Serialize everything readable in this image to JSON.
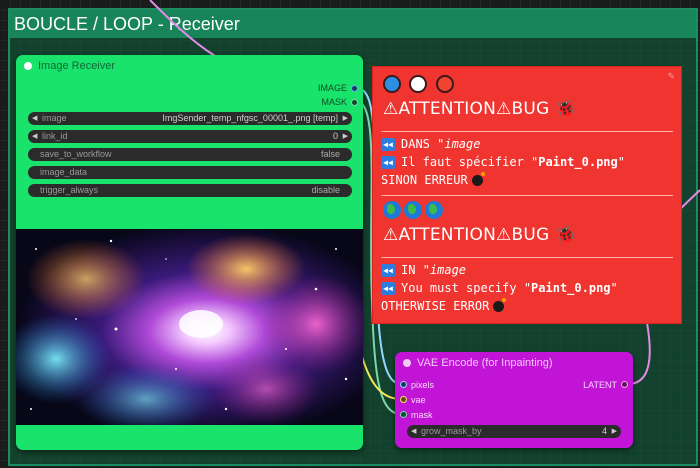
{
  "group": {
    "title": "BOUCLE / LOOP - Receiver"
  },
  "image_receiver": {
    "title": "Image Receiver",
    "outputs": [
      "IMAGE",
      "MASK"
    ],
    "widgets": {
      "image": {
        "label": "image",
        "value": "ImgSender_temp_nfgsc_00001_.png [temp]"
      },
      "link_id": {
        "label": "link_id",
        "value": "0"
      },
      "save_to_workflow": {
        "label": "save_to_workflow",
        "value": "false"
      },
      "image_data": {
        "label": "image_data",
        "value": ""
      },
      "trigger_always": {
        "label": "trigger_always",
        "value": "disable"
      }
    },
    "preview": "colorful nebula image"
  },
  "note": {
    "circles": [
      "#2b8fe3",
      "#ffffff",
      "#f0442f"
    ],
    "fr": {
      "heading_attention": "ATTENTION",
      "heading_bug": "BUG",
      "line1_prefix": "DANS \"",
      "line1_em": "image",
      "line2_prefix": "Il faut spécifier \"",
      "line2_bold": "Paint_0.png",
      "line2_suffix": "\"",
      "line3": "SINON ERREUR"
    },
    "en": {
      "heading_attention": "ATTENTION",
      "heading_bug": "BUG",
      "line1_prefix": "IN \"",
      "line1_em": "image",
      "line2_prefix": "You must specify \"",
      "line2_bold": "Paint_0.png",
      "line2_suffix": "\"",
      "line3": "OTHERWISE ERROR"
    }
  },
  "vae_encode": {
    "title": "VAE Encode (for Inpainting)",
    "inputs": [
      "pixels",
      "vae",
      "mask"
    ],
    "output": "LATENT",
    "widget": {
      "label": "grow_mask_by",
      "value": "4"
    }
  },
  "colors": {
    "receiver_node": "#19e36a",
    "note_bg": "#f0342f",
    "vae_node": "#c214d6",
    "wire_pink": "#e28be6",
    "wire_green": "#7bd8a8",
    "wire_yellow": "#f5e65a"
  }
}
